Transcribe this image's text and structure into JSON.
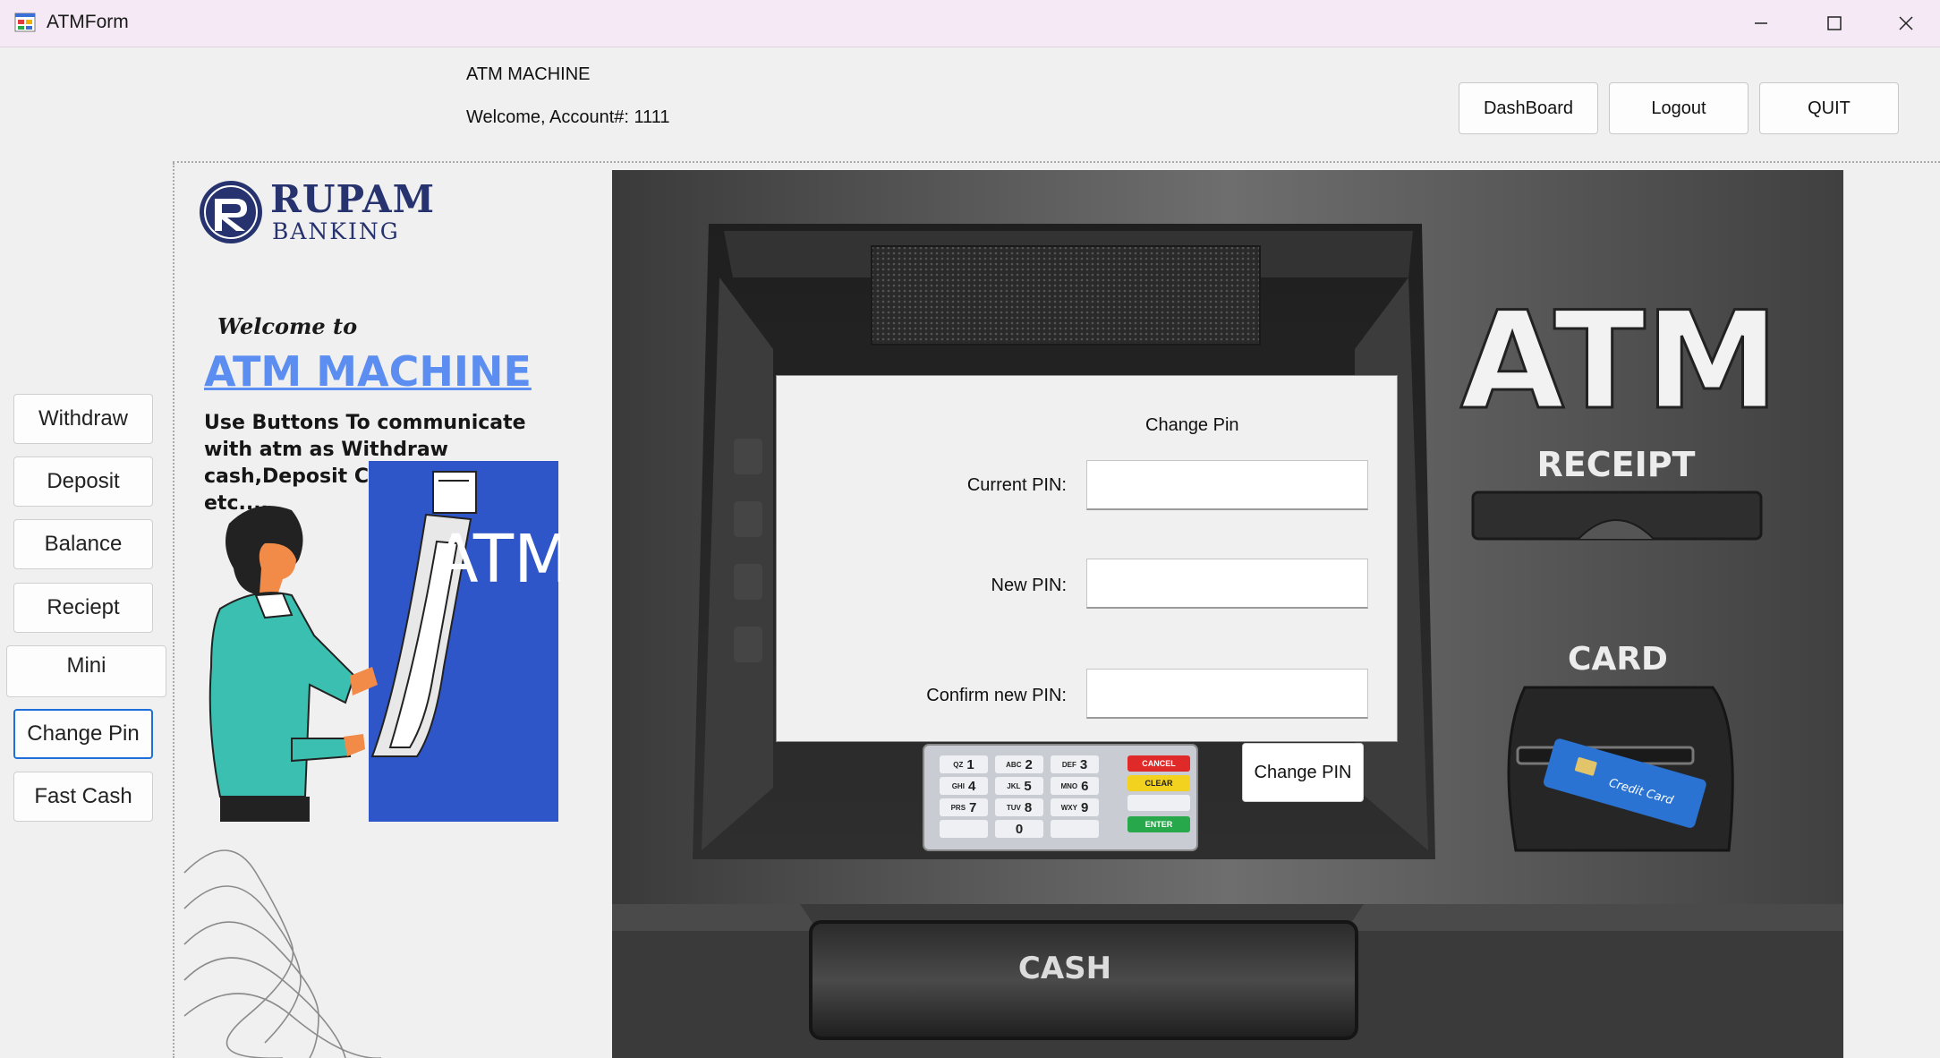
{
  "window": {
    "title": "ATMForm",
    "controls": [
      "minimize",
      "maximize",
      "close"
    ]
  },
  "header": {
    "app_label": "ATM MACHINE",
    "welcome": "Welcome, Account#: 1111",
    "buttons": {
      "dashboard": "DashBoard",
      "logout": "Logout",
      "quit": "QUIT"
    }
  },
  "sidebar": {
    "items": [
      {
        "label": "Withdraw"
      },
      {
        "label": "Deposit"
      },
      {
        "label": "Balance"
      },
      {
        "label": "Reciept"
      },
      {
        "label": "Mini"
      },
      {
        "label": "Change Pin",
        "active": true
      },
      {
        "label": "Fast Cash"
      }
    ]
  },
  "info_panel": {
    "brand_name": "RUPAM",
    "brand_sub": "BANKING",
    "welcome_to": "Welcome to",
    "heading": "ATM MACHINE",
    "description": "Use Buttons To communicate with atm as Withdraw cash,Deposit Cash,Fast Cash etc....",
    "illustration_text": "ATM"
  },
  "atm": {
    "sign": "ATM",
    "receipt_label": "RECEIPT",
    "card_label": "CARD",
    "cash_label": "CASH",
    "card_text": "Credit Card",
    "keypad": {
      "keys": [
        {
          "sub": "QZ",
          "num": "1"
        },
        {
          "sub": "ABC",
          "num": "2"
        },
        {
          "sub": "DEF",
          "num": "3"
        },
        {
          "sub": "GHI",
          "num": "4"
        },
        {
          "sub": "JKL",
          "num": "5"
        },
        {
          "sub": "MNO",
          "num": "6"
        },
        {
          "sub": "PRS",
          "num": "7"
        },
        {
          "sub": "TUV",
          "num": "8"
        },
        {
          "sub": "WXY",
          "num": "9"
        },
        {
          "sub": "",
          "num": ""
        },
        {
          "sub": "",
          "num": "0"
        },
        {
          "sub": "",
          "num": ""
        }
      ],
      "cancel": "CANCEL",
      "clear": "CLEAR",
      "enter": "ENTER"
    }
  },
  "change_pin_form": {
    "title": "Change Pin",
    "current_label": "Current PIN:",
    "current_value": "",
    "new_label": "New  PIN:",
    "new_value": "",
    "confirm_label": "Confirm new PIN:",
    "confirm_value": "",
    "submit": "Change PIN"
  },
  "colors": {
    "titlebar": "#f4e9f4",
    "background": "#f0f0f0",
    "brand": "#27336e",
    "heading": "#5b8ef0",
    "active_border": "#1e6fd9",
    "illustration_blue": "#2f56c9",
    "person_shirt": "#3bbfb0"
  }
}
